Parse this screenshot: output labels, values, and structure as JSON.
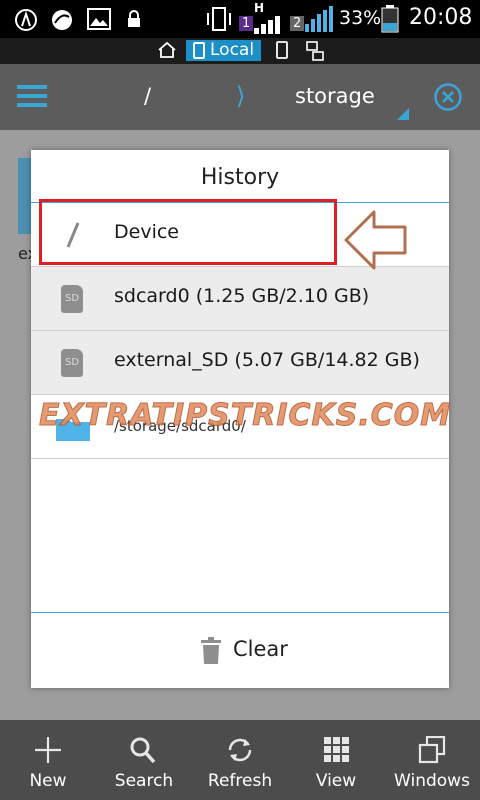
{
  "status_bar": {
    "signal_h": "H",
    "sim1": "1",
    "sim2": "2",
    "battery": "33%",
    "time": "20:08"
  },
  "location_bar": {
    "local_label": "Local"
  },
  "header": {
    "path_root": "/",
    "path_current": "storage",
    "chevron": "⟩"
  },
  "background": {
    "partial_label": "ex"
  },
  "dialog": {
    "title": "History",
    "items": [
      {
        "label": "Device",
        "icon": "slash-icon"
      },
      {
        "label": "sdcard0 (1.25 GB/2.10 GB)",
        "icon": "sd-card-icon",
        "icon_text": "SD"
      },
      {
        "label": "external_SD (5.07 GB/14.82 GB)",
        "icon": "sd-card-icon",
        "icon_text": "SD"
      },
      {
        "label": "/storage/sdcard0/",
        "icon": "folder-icon"
      }
    ],
    "clear_label": "Clear"
  },
  "watermark": "EXTRATIPSTRICKS.COM",
  "toolbar": {
    "items": [
      {
        "label": "New",
        "icon": "plus-icon"
      },
      {
        "label": "Search",
        "icon": "search-icon"
      },
      {
        "label": "Refresh",
        "icon": "refresh-icon"
      },
      {
        "label": "View",
        "icon": "grid-icon"
      },
      {
        "label": "Windows",
        "icon": "windows-icon"
      }
    ]
  },
  "colors": {
    "accent": "#3aa6d6",
    "highlight": "#e02025",
    "arrow": "#b07050"
  }
}
